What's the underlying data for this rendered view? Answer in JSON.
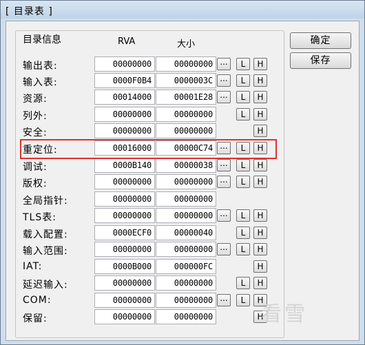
{
  "window": {
    "title": "[ 目录表 ]"
  },
  "group": {
    "title": "目录信息",
    "col_rva": "RVA",
    "col_size": "大小"
  },
  "buttons": {
    "ok": "确定",
    "save": "保存"
  },
  "btn_labels": {
    "dots": "...",
    "l": "L",
    "h": "H"
  },
  "rows": [
    {
      "label": "输出表:",
      "rva": "00000000",
      "size": "00000000",
      "dots": true,
      "l": true,
      "h": true
    },
    {
      "label": "输入表:",
      "rva": "0000F0B4",
      "size": "0000003C",
      "dots": true,
      "l": true,
      "h": true
    },
    {
      "label": "资源:",
      "rva": "00014000",
      "size": "00001E28",
      "dots": true,
      "l": true,
      "h": true
    },
    {
      "label": "列外:",
      "rva": "00000000",
      "size": "00000000",
      "dots": false,
      "l": true,
      "h": true
    },
    {
      "label": "安全:",
      "rva": "00000000",
      "size": "00000000",
      "dots": false,
      "l": false,
      "h": true
    },
    {
      "label": "重定位:",
      "rva": "00016000",
      "size": "00000C74",
      "dots": true,
      "l": true,
      "h": true
    },
    {
      "label": "调试:",
      "rva": "0000B140",
      "size": "00000038",
      "dots": true,
      "l": true,
      "h": true
    },
    {
      "label": "版权:",
      "rva": "00000000",
      "size": "00000000",
      "dots": true,
      "l": true,
      "h": true
    },
    {
      "label": "全局指针:",
      "rva": "00000000",
      "size": "00000000",
      "dots": false,
      "l": false,
      "h": false
    },
    {
      "label": "TLS表:",
      "rva": "00000000",
      "size": "00000000",
      "dots": true,
      "l": true,
      "h": true
    },
    {
      "label": "载入配置:",
      "rva": "0000ECF0",
      "size": "00000040",
      "dots": false,
      "l": true,
      "h": true
    },
    {
      "label": "输入范围:",
      "rva": "00000000",
      "size": "00000000",
      "dots": true,
      "l": true,
      "h": true
    },
    {
      "label": "IAT:",
      "rva": "0000B000",
      "size": "000000FC",
      "dots": false,
      "l": false,
      "h": true
    },
    {
      "label": "延迟输入:",
      "rva": "00000000",
      "size": "00000000",
      "dots": false,
      "l": true,
      "h": true
    },
    {
      "label": "COM:",
      "rva": "00000000",
      "size": "00000000",
      "dots": true,
      "l": true,
      "h": true
    },
    {
      "label": "保留:",
      "rva": "00000000",
      "size": "00000000",
      "dots": false,
      "l": false,
      "h": true
    }
  ],
  "watermark": "看雪",
  "colors": {
    "highlight": "#e03030",
    "window_frame": "#cfdeec",
    "client": "#f0f0f0"
  }
}
